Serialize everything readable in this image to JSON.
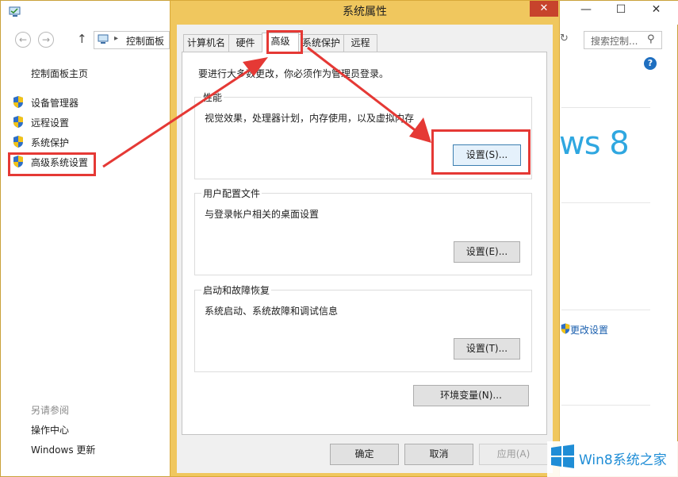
{
  "control_panel": {
    "address": {
      "separator": "▸",
      "text": "控制面板"
    },
    "search_placeholder": "搜索控制...",
    "controls": {
      "minimize": "—",
      "maximize": "☐",
      "close": "✕"
    },
    "help": "?",
    "sidebar": {
      "home": "控制面板主页",
      "links": [
        {
          "label": "设备管理器"
        },
        {
          "label": "远程设置"
        },
        {
          "label": "系统保护"
        },
        {
          "label": "高级系统设置"
        }
      ],
      "see_also_title": "另请参阅",
      "see_also": [
        {
          "label": "操作中心"
        },
        {
          "label": "Windows 更新"
        }
      ]
    },
    "right": {
      "logo_text": "ws 8",
      "change_settings": "更改设置"
    }
  },
  "dialog": {
    "title": "系统属性",
    "close": "✕",
    "tabs": [
      {
        "label": "计算机名"
      },
      {
        "label": "硬件"
      },
      {
        "label": "高级",
        "active": true
      },
      {
        "label": "系统保护"
      },
      {
        "label": "远程"
      }
    ],
    "admin_note": "要进行大多数更改，你必须作为管理员登录。",
    "groups": [
      {
        "title": "性能",
        "desc": "视觉效果，处理器计划，内存使用，以及虚拟内存",
        "button": "设置(S)..."
      },
      {
        "title": "用户配置文件",
        "desc": "与登录帐户相关的桌面设置",
        "button": "设置(E)..."
      },
      {
        "title": "启动和故障恢复",
        "desc": "系统启动、系统故障和调试信息",
        "button": "设置(T)..."
      }
    ],
    "env_button": "环境变量(N)...",
    "ok": "确定",
    "cancel": "取消",
    "apply": "应用(A)"
  },
  "watermark": {
    "text": "Win8系统之家"
  },
  "colors": {
    "highlight": "#e53935",
    "dialog_frame": "#f0c75e",
    "close_button": "#c7432c",
    "link": "#1a5fae",
    "win8_blue": "#2fa7e0"
  }
}
